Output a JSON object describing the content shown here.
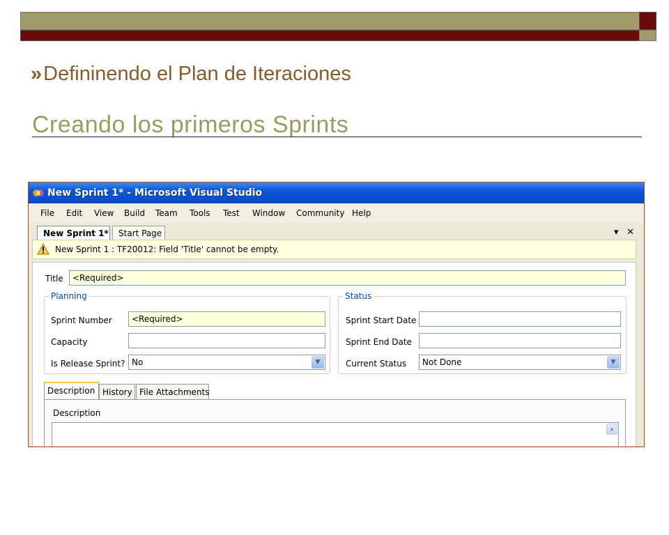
{
  "slide": {
    "title": "Defininendo el Plan de Iteraciones",
    "subtitle": "Creando los primeros Sprints",
    "bullet_glyph": "»",
    "colors": {
      "bar_olive": "#a19b6a",
      "bar_maroon": "#6b0a0a",
      "title": "#8b5a2b",
      "subtitle": "#9d9a60"
    }
  },
  "window": {
    "title": "New Sprint 1* - Microsoft Visual Studio",
    "menu": [
      "File",
      "Edit",
      "View",
      "Build",
      "Team",
      "Tools",
      "Test",
      "Window",
      "Community",
      "Help"
    ],
    "tabs": [
      {
        "label": "New Sprint 1*",
        "active": true
      },
      {
        "label": "Start Page",
        "active": false
      }
    ],
    "tab_controls": {
      "dropdown": "▾",
      "close": "✕"
    },
    "warning": "New Sprint 1 : TF20012: Field 'Title' cannot be empty."
  },
  "form": {
    "title_label": "Title",
    "title_value": "<Required>",
    "planning": {
      "legend": "Planning",
      "sprint_number_label": "Sprint Number",
      "sprint_number_value": "<Required>",
      "capacity_label": "Capacity",
      "capacity_value": "",
      "release_label": "Is Release Sprint?",
      "release_value": "No"
    },
    "status": {
      "legend": "Status",
      "start_label": "Sprint Start Date",
      "start_value": "",
      "end_label": "Sprint End Date",
      "end_value": "",
      "current_label": "Current Status",
      "current_value": "Not Done"
    },
    "inner_tabs": [
      "Description",
      "History",
      "File Attachments"
    ],
    "description_label": "Description"
  }
}
